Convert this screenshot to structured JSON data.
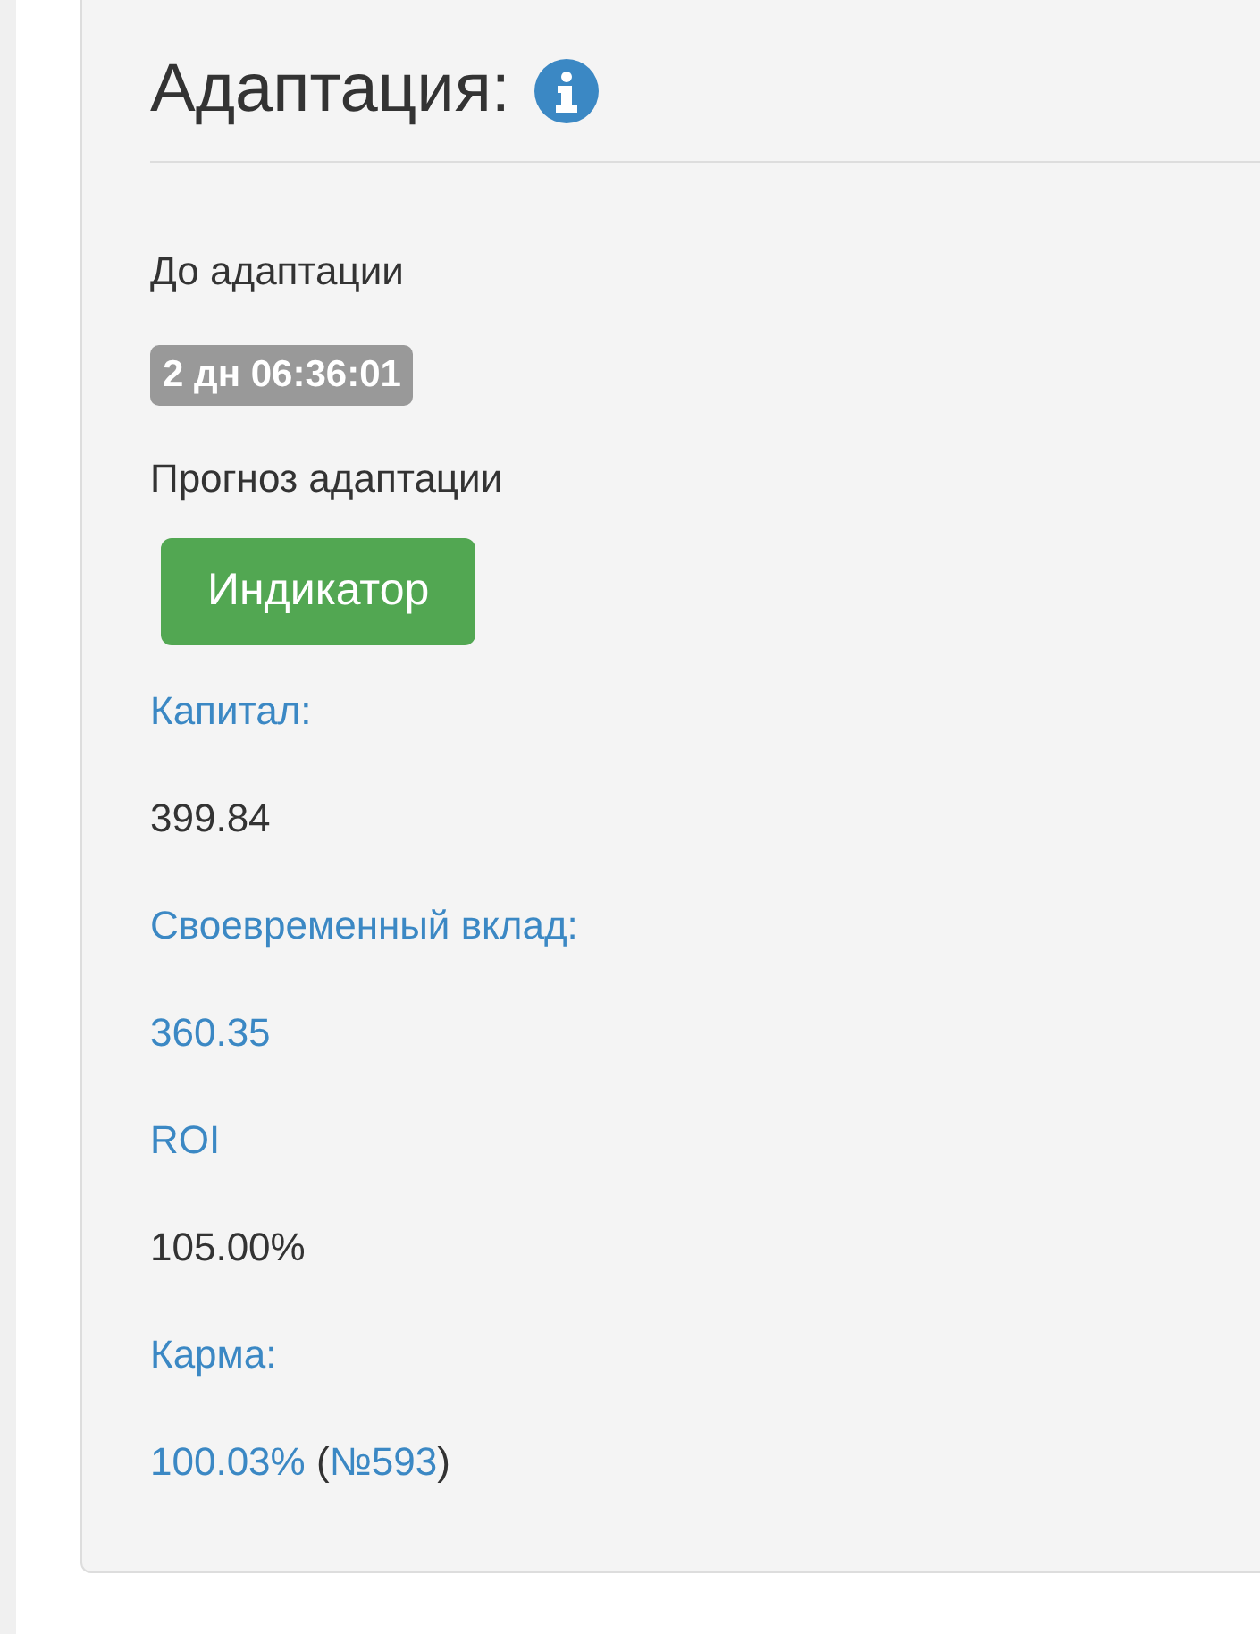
{
  "panel": {
    "title": "Адаптация:",
    "items": [
      {
        "kind": "text",
        "text": "До адаптации"
      },
      {
        "kind": "badge",
        "text": "2 дн 06:36:01"
      },
      {
        "kind": "text",
        "text": "Прогноз адаптации"
      },
      {
        "kind": "button",
        "text": "Индикатор"
      },
      {
        "kind": "link",
        "text": "Капитал:"
      },
      {
        "kind": "text",
        "text": "399.84"
      },
      {
        "kind": "link",
        "text": "Своевременный вклад:"
      },
      {
        "kind": "link",
        "text": "360.35"
      },
      {
        "kind": "link",
        "text": "ROI"
      },
      {
        "kind": "text",
        "text": "105.00%"
      },
      {
        "kind": "link",
        "text": "Карма:"
      },
      {
        "kind": "mixed",
        "parts": [
          {
            "kind": "link",
            "text": "100.03%"
          },
          {
            "kind": "text",
            "text": " ("
          },
          {
            "kind": "link",
            "text": "№593"
          },
          {
            "kind": "text",
            "text": ")"
          }
        ]
      }
    ]
  }
}
